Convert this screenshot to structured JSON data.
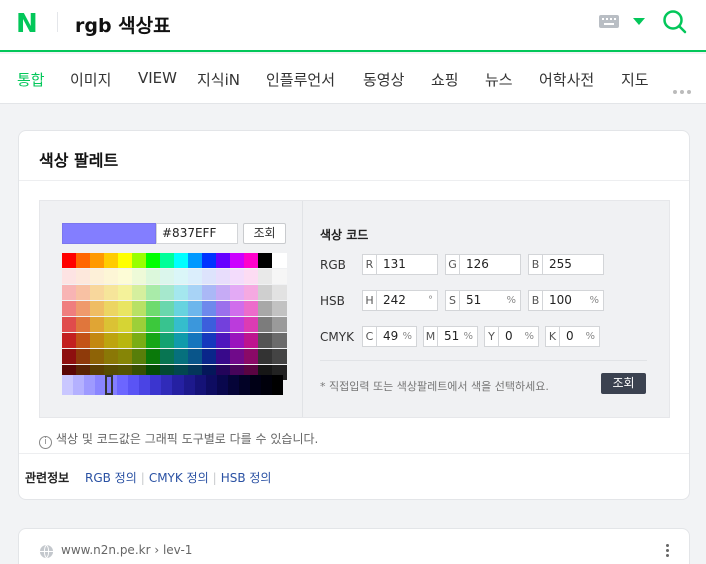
{
  "header": {
    "logo": "N",
    "query": "rgb 색상표"
  },
  "tabs": [
    "통합",
    "이미지",
    "VIEW",
    "지식iN",
    "인플루언서",
    "동영상",
    "쇼핑",
    "뉴스",
    "어학사전",
    "지도"
  ],
  "palette_card": {
    "title": "색상 팔레트",
    "hex_value": "#837EFF",
    "lookup_label": "조회",
    "code_title": "색상 코드",
    "rgb": {
      "label": "RGB",
      "r": "131",
      "g": "126",
      "b": "255"
    },
    "hsb": {
      "label": "HSB",
      "h": "242",
      "s": "51",
      "b": "100",
      "unit_deg": "°",
      "unit_pct": "%"
    },
    "cmyk": {
      "label": "CMYK",
      "c": "49",
      "m": "51",
      "y": "0",
      "k": "0",
      "unit_pct": "%"
    },
    "field_keys": {
      "r": "R",
      "g": "G",
      "b": "B",
      "h": "H",
      "s": "S",
      "c": "C",
      "m": "M",
      "y": "Y",
      "k": "K"
    },
    "hint": "* 직접입력 또는 색상팔레트에서 색을 선택하세요.",
    "lookup_label2": "조회",
    "info": "색상 및 코드값은 그래픽 도구별로 다를 수 있습니다.",
    "related_label": "관련정보",
    "related_links": [
      "RGB 정의",
      "CMYK 정의",
      "HSB 정의"
    ],
    "palette_rows": [
      [
        "#ff0000",
        "#ff6600",
        "#ff9900",
        "#ffcc00",
        "#ffff00",
        "#99ff00",
        "#00ff00",
        "#00ff99",
        "#00ffff",
        "#0099ff",
        "#0033ff",
        "#6600ff",
        "#cc00ff",
        "#ff00cc",
        "#000000",
        "#ffffff"
      ],
      [
        "#fde3e3",
        "#fde8dc",
        "#fdf0d8",
        "#fdf6d6",
        "#fdfcd6",
        "#eefad8",
        "#dcf8dc",
        "#dbf6ec",
        "#daf6f8",
        "#dbeefc",
        "#dde3fc",
        "#e8ddfc",
        "#f3dcfc",
        "#fcdcf3",
        "#e9e9e9",
        "#f6f6f6"
      ],
      [
        "#f8b4b4",
        "#f8c1a3",
        "#f8d79c",
        "#f6e59a",
        "#f4f29a",
        "#d5ef9e",
        "#a9eba9",
        "#a6e8cd",
        "#a4e7ee",
        "#a8d3f6",
        "#aab8f6",
        "#c6abf5",
        "#e3aaf5",
        "#f5a9e1",
        "#cfcfcf",
        "#e2e2e2"
      ],
      [
        "#ef7e7e",
        "#ef9a6c",
        "#efbd63",
        "#ecd562",
        "#e9e562",
        "#b8e165",
        "#6edb6e",
        "#6ad7ad",
        "#67d3df",
        "#6db6ec",
        "#6e89ec",
        "#9b70ec",
        "#d06dec",
        "#ec6ccb",
        "#a8a8a8",
        "#c2c2c2"
      ],
      [
        "#e04c4c",
        "#e0763c",
        "#e0a534",
        "#dbc234",
        "#d6d434",
        "#9ccf39",
        "#3cc83c",
        "#38c38f",
        "#35bdcc",
        "#3b97dc",
        "#3c5edc",
        "#7340dc",
        "#bb3bdc",
        "#dc3bb3",
        "#7c7c7c",
        "#9a9a9a"
      ],
      [
        "#c32020",
        "#c35316",
        "#c38810",
        "#bda40f",
        "#b8b60f",
        "#7aad14",
        "#16a616",
        "#13a271",
        "#109bab",
        "#1575bd",
        "#1638bd",
        "#4f17bd",
        "#9a14bd",
        "#bd148f",
        "#545454",
        "#6b6b6b"
      ],
      [
        "#8e0f0f",
        "#8e3a0a",
        "#8e6306",
        "#8a7806",
        "#868506",
        "#587e0a",
        "#0a790a",
        "#087552",
        "#06707d",
        "#09558a",
        "#0a268a",
        "#38098a",
        "#700a8a",
        "#8a0a67",
        "#333333",
        "#444444"
      ],
      [
        "#5a0606",
        "#5a2404",
        "#5a3e02",
        "#574c02",
        "#555402",
        "#375003",
        "#044c04",
        "#034a34",
        "#02474f",
        "#03365a",
        "#04175a",
        "#23045a",
        "#47045a",
        "#5a0442",
        "#161616",
        "#222222"
      ]
    ],
    "gradient": [
      "#c9c7ff",
      "#b4b1ff",
      "#9e9aff",
      "#8a85ff",
      "#837eff",
      "#6c66ff",
      "#5a54f5",
      "#4a44e4",
      "#3b35cf",
      "#302bb9",
      "#2520a2",
      "#1d198c",
      "#151277",
      "#0e0c61",
      "#09074d",
      "#050438",
      "#020226",
      "#000016",
      "#00000b",
      "#000000"
    ]
  },
  "result": {
    "site": "www.n2n.pe.kr",
    "path": "lev-1"
  }
}
